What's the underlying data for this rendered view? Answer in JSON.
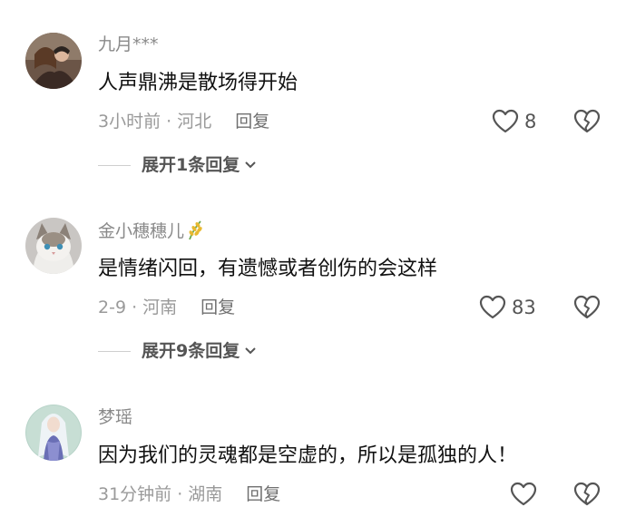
{
  "comments": [
    {
      "username": "九月***",
      "text": "人声鼎沸是散场得开始",
      "meta": "3小时前 · 河北",
      "reply_label": "回复",
      "likes": "8",
      "expand_label": "展开1条回复"
    },
    {
      "username": "金小穗穗儿",
      "username_icon": "rice-icon",
      "text": "是情绪闪回，有遗憾或者创伤的会这样",
      "meta": "2-9 · 河南",
      "reply_label": "回复",
      "likes": "83",
      "expand_label": "展开9条回复"
    },
    {
      "username": "梦瑶",
      "text": "因为我们的灵魂都是空虚的，所以是孤独的人！",
      "meta": "31分钟前 · 湖南",
      "reply_label": "回复",
      "likes": ""
    }
  ],
  "icons": {
    "like": "heart-outline-icon",
    "dislike": "broken-heart-icon",
    "expand": "chevron-down-icon"
  },
  "colors": {
    "text": "#111111",
    "muted": "#8a8a8a",
    "icon": "#555555"
  }
}
